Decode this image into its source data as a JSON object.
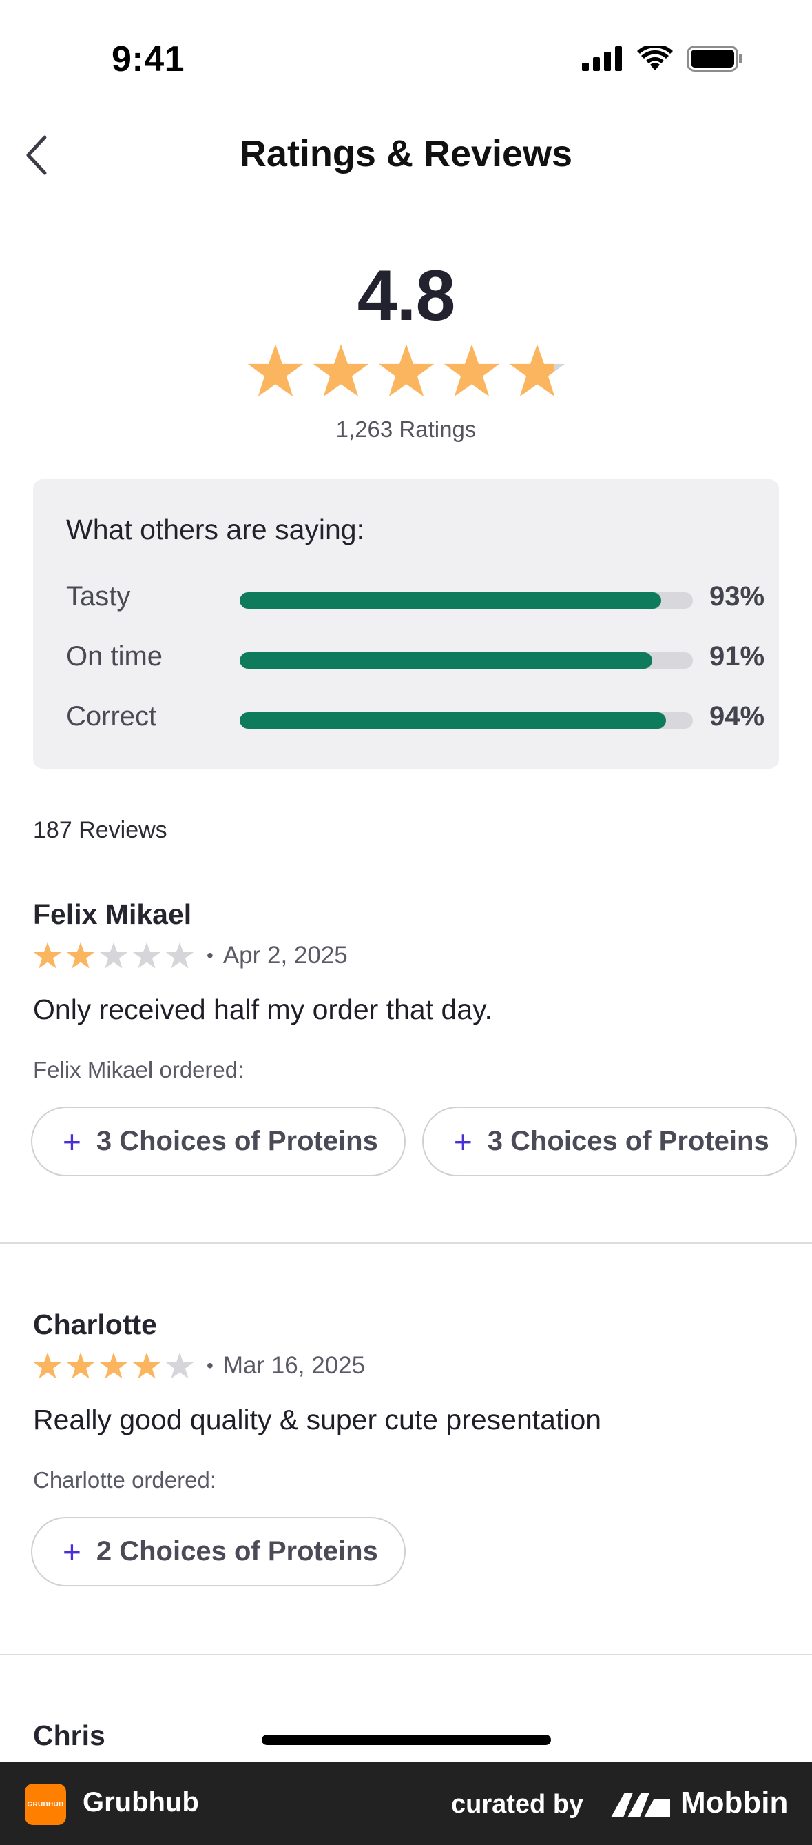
{
  "status_bar": {
    "time": "9:41"
  },
  "header": {
    "title": "Ratings & Reviews"
  },
  "summary": {
    "rating": "4.8",
    "stars_value": 4.8,
    "ratings_count": "1,263 Ratings"
  },
  "saying": {
    "title": "What others are saying:",
    "metrics": [
      {
        "label": "Tasty",
        "percent_text": "93%",
        "value": 0.93
      },
      {
        "label": "On time",
        "percent_text": "91%",
        "value": 0.91
      },
      {
        "label": "Correct",
        "percent_text": "94%",
        "value": 0.94
      }
    ]
  },
  "reviews_count": "187 Reviews",
  "reviews": [
    {
      "name": "Felix Mikael",
      "stars": 2,
      "date": "Apr 2, 2025",
      "text": "Only received half my order that day.",
      "ordered_label": "Felix Mikael ordered:",
      "chips": [
        "3 Choices of Proteins",
        "3 Choices of Proteins"
      ]
    },
    {
      "name": "Charlotte",
      "stars": 4,
      "date": "Mar 16, 2025",
      "text": "Really good quality & super cute presentation",
      "ordered_label": "Charlotte ordered:",
      "chips": [
        "2 Choices of Proteins"
      ]
    },
    {
      "name": "Chris"
    }
  ],
  "footer": {
    "app_logo_text": "GRUBHUB",
    "app_name": "Grubhub",
    "curated_by": "curated by",
    "brand": "Mobbin"
  },
  "colors": {
    "star": "#fbb55f",
    "star_empty": "#d6d6da",
    "bar_fill": "#0e7c5c",
    "accent": "#4a2fd6"
  }
}
